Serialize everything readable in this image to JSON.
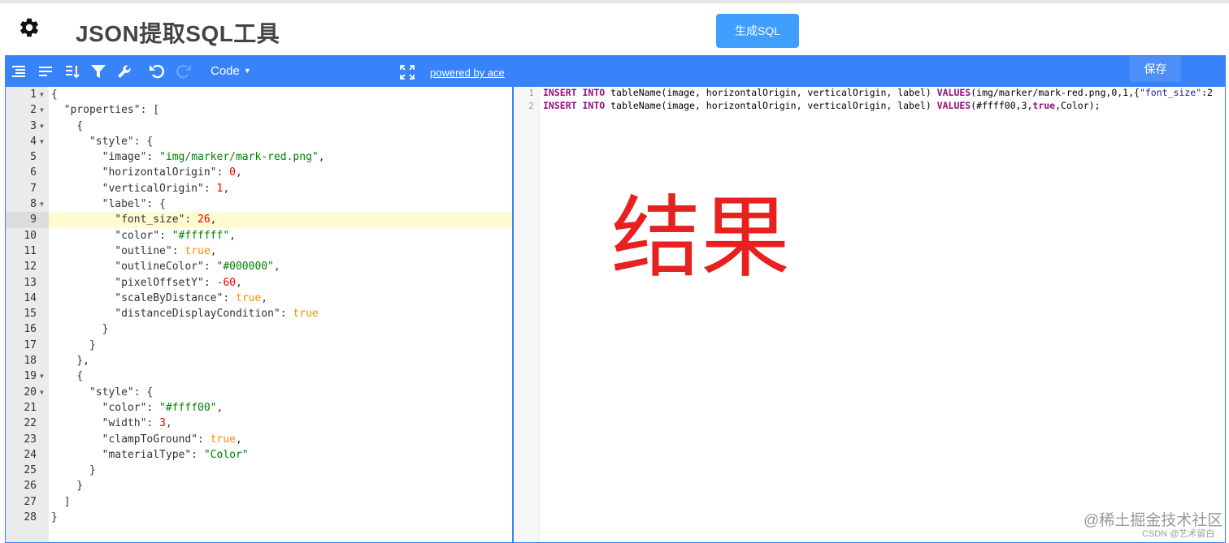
{
  "header": {
    "title": "JSON提取SQL工具",
    "generate_button": "生成SQL"
  },
  "left_editor": {
    "menubar": {
      "icons": [
        "format-icon",
        "compact-icon",
        "sort-icon",
        "filter-icon",
        "repair-icon",
        "undo-icon",
        "redo-icon"
      ],
      "mode_label": "Code",
      "fullscreen_icon": "fullscreen-icon",
      "powered_by": "powered by ace"
    },
    "active_line": 9,
    "lines": [
      {
        "n": "1",
        "fold": true,
        "tokens": [
          {
            "t": "{",
            "c": "k"
          }
        ]
      },
      {
        "n": "2",
        "fold": true,
        "tokens": [
          {
            "t": "  \"properties\": [",
            "c": "k"
          }
        ]
      },
      {
        "n": "3",
        "fold": true,
        "tokens": [
          {
            "t": "    {",
            "c": "k"
          }
        ]
      },
      {
        "n": "4",
        "fold": true,
        "tokens": [
          {
            "t": "      \"style\": {",
            "c": "k"
          }
        ]
      },
      {
        "n": "5",
        "fold": false,
        "tokens": [
          {
            "t": "        \"image\": ",
            "c": "k"
          },
          {
            "t": "\"img/marker/mark-red.png\"",
            "c": "s"
          },
          {
            "t": ",",
            "c": "k"
          }
        ]
      },
      {
        "n": "6",
        "fold": false,
        "tokens": [
          {
            "t": "        \"horizontalOrigin\": ",
            "c": "k"
          },
          {
            "t": "0",
            "c": "n"
          },
          {
            "t": ",",
            "c": "k"
          }
        ]
      },
      {
        "n": "7",
        "fold": false,
        "tokens": [
          {
            "t": "        \"verticalOrigin\": ",
            "c": "k"
          },
          {
            "t": "1",
            "c": "n"
          },
          {
            "t": ",",
            "c": "k"
          }
        ]
      },
      {
        "n": "8",
        "fold": true,
        "tokens": [
          {
            "t": "        \"label\": {",
            "c": "k"
          }
        ]
      },
      {
        "n": "9",
        "fold": false,
        "tokens": [
          {
            "t": "          \"font_size\": ",
            "c": "k"
          },
          {
            "t": "26",
            "c": "n"
          },
          {
            "t": ",",
            "c": "k"
          }
        ]
      },
      {
        "n": "10",
        "fold": false,
        "tokens": [
          {
            "t": "          \"color\": ",
            "c": "k"
          },
          {
            "t": "\"#ffffff\"",
            "c": "s"
          },
          {
            "t": ",",
            "c": "k"
          }
        ]
      },
      {
        "n": "11",
        "fold": false,
        "tokens": [
          {
            "t": "          \"outline\": ",
            "c": "k"
          },
          {
            "t": "true",
            "c": "b"
          },
          {
            "t": ",",
            "c": "k"
          }
        ]
      },
      {
        "n": "12",
        "fold": false,
        "tokens": [
          {
            "t": "          \"outlineColor\": ",
            "c": "k"
          },
          {
            "t": "\"#000000\"",
            "c": "s"
          },
          {
            "t": ",",
            "c": "k"
          }
        ]
      },
      {
        "n": "13",
        "fold": false,
        "tokens": [
          {
            "t": "          \"pixelOffsetY\": ",
            "c": "k"
          },
          {
            "t": "-60",
            "c": "n"
          },
          {
            "t": ",",
            "c": "k"
          }
        ]
      },
      {
        "n": "14",
        "fold": false,
        "tokens": [
          {
            "t": "          \"scaleByDistance\": ",
            "c": "k"
          },
          {
            "t": "true",
            "c": "b"
          },
          {
            "t": ",",
            "c": "k"
          }
        ]
      },
      {
        "n": "15",
        "fold": false,
        "tokens": [
          {
            "t": "          \"distanceDisplayCondition\": ",
            "c": "k"
          },
          {
            "t": "true",
            "c": "b"
          }
        ]
      },
      {
        "n": "16",
        "fold": false,
        "tokens": [
          {
            "t": "        }",
            "c": "k"
          }
        ]
      },
      {
        "n": "17",
        "fold": false,
        "tokens": [
          {
            "t": "      }",
            "c": "k"
          }
        ]
      },
      {
        "n": "18",
        "fold": false,
        "tokens": [
          {
            "t": "    },",
            "c": "k"
          }
        ]
      },
      {
        "n": "19",
        "fold": true,
        "tokens": [
          {
            "t": "    {",
            "c": "k"
          }
        ]
      },
      {
        "n": "20",
        "fold": true,
        "tokens": [
          {
            "t": "      \"style\": {",
            "c": "k"
          }
        ]
      },
      {
        "n": "21",
        "fold": false,
        "tokens": [
          {
            "t": "        \"color\": ",
            "c": "k"
          },
          {
            "t": "\"#ffff00\"",
            "c": "s"
          },
          {
            "t": ",",
            "c": "k"
          }
        ]
      },
      {
        "n": "22",
        "fold": false,
        "tokens": [
          {
            "t": "        \"width\": ",
            "c": "k"
          },
          {
            "t": "3",
            "c": "n"
          },
          {
            "t": ",",
            "c": "k"
          }
        ]
      },
      {
        "n": "23",
        "fold": false,
        "tokens": [
          {
            "t": "        \"clampToGround\": ",
            "c": "k"
          },
          {
            "t": "true",
            "c": "b"
          },
          {
            "t": ",",
            "c": "k"
          }
        ]
      },
      {
        "n": "24",
        "fold": false,
        "tokens": [
          {
            "t": "        \"materialType\": ",
            "c": "k"
          },
          {
            "t": "\"Color\"",
            "c": "s"
          }
        ]
      },
      {
        "n": "25",
        "fold": false,
        "tokens": [
          {
            "t": "      }",
            "c": "k"
          }
        ]
      },
      {
        "n": "26",
        "fold": false,
        "tokens": [
          {
            "t": "    }",
            "c": "k"
          }
        ]
      },
      {
        "n": "27",
        "fold": false,
        "tokens": [
          {
            "t": "  ]",
            "c": "k"
          }
        ]
      },
      {
        "n": "28",
        "fold": false,
        "tokens": [
          {
            "t": "}",
            "c": "k"
          }
        ]
      }
    ]
  },
  "right_editor": {
    "save_button": "保存",
    "lines": [
      {
        "n": "1",
        "tokens": [
          {
            "t": "INSERT",
            "c": "kw"
          },
          {
            "t": " ",
            "c": "nm"
          },
          {
            "t": "INTO",
            "c": "kw"
          },
          {
            "t": " tableName(image, horizontalOrigin, verticalOrigin, label) ",
            "c": "nm"
          },
          {
            "t": "VALUES",
            "c": "kw"
          },
          {
            "t": "(img/marker/mark-red.png,0,1,{",
            "c": "nm"
          },
          {
            "t": "\"font_size\"",
            "c": "str"
          },
          {
            "t": ":2",
            "c": "nm"
          }
        ]
      },
      {
        "n": "2",
        "tokens": [
          {
            "t": "INSERT",
            "c": "kw"
          },
          {
            "t": " ",
            "c": "nm"
          },
          {
            "t": "INTO",
            "c": "kw"
          },
          {
            "t": " tableName(image, horizontalOrigin, verticalOrigin, label) ",
            "c": "nm"
          },
          {
            "t": "VALUES",
            "c": "kw"
          },
          {
            "t": "(#ffff00,3,",
            "c": "nm"
          },
          {
            "t": "true",
            "c": "kw"
          },
          {
            "t": ",Color);",
            "c": "nm"
          }
        ]
      }
    ],
    "annotation": "结果"
  },
  "watermark": {
    "main": "@稀土掘金技术社区",
    "sub": "CSDN @艺术留白"
  },
  "colors": {
    "menubar": "#3883fa",
    "button": "#409eff",
    "annotation": "#e82020"
  }
}
